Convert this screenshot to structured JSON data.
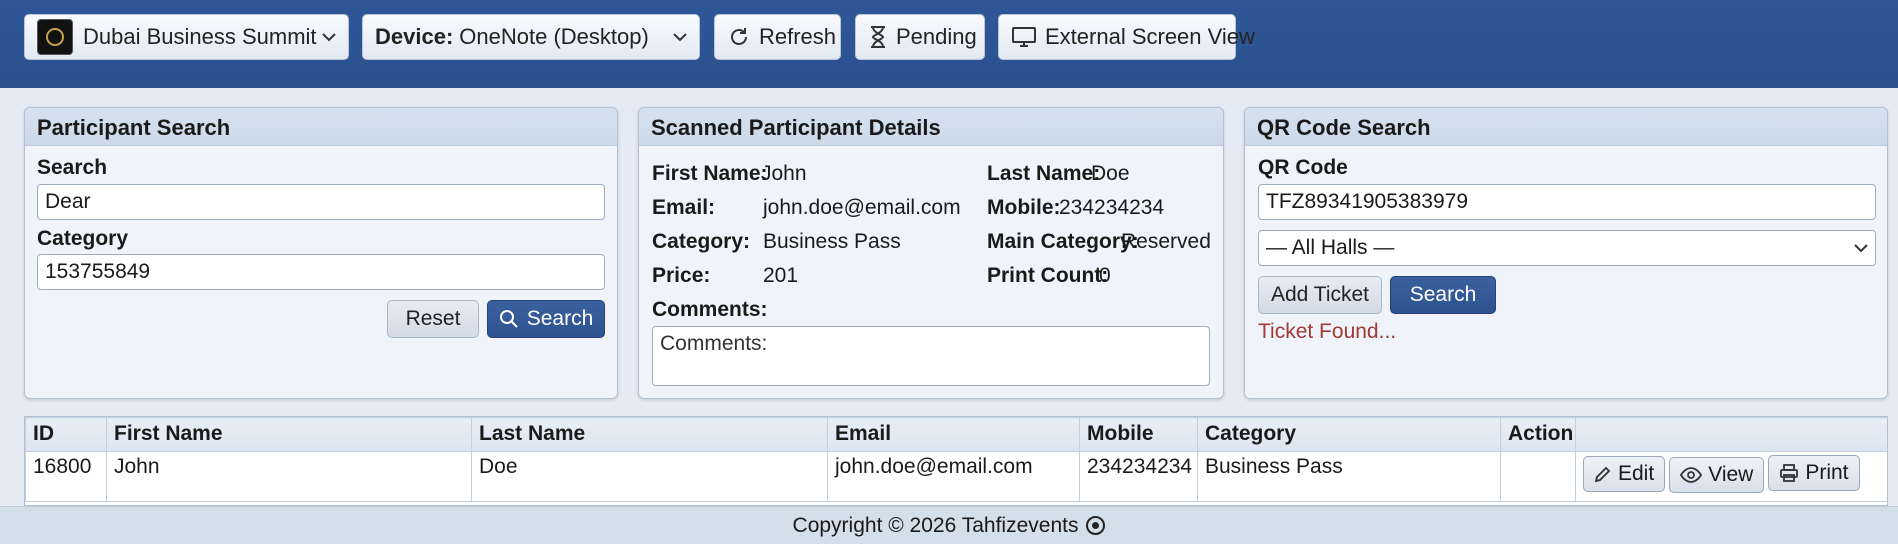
{
  "topbar": {
    "event_name": "Dubai Business Summit",
    "device_label": "Device:",
    "device_value": "OneNote (Desktop)",
    "refresh_label": "Refresh",
    "pending_label": "Pending",
    "external_label": "External Screen View"
  },
  "participant_search": {
    "title": "Participant Search",
    "search_label": "Search",
    "search_value": "Dear",
    "category_label": "Category",
    "category_value": "153755849",
    "reset_label": "Reset",
    "search_button": "Search"
  },
  "scanned": {
    "title": "Scanned Participant Details",
    "first_name_label": "First Name:",
    "first_name": "John",
    "last_name_label": "Last Name:",
    "last_name": "Doe",
    "email_label": "Email:",
    "email": "john.doe@email.com",
    "mobile_label": "Mobile:",
    "mobile": "234234234",
    "category_label": "Category:",
    "category": "Business Pass",
    "main_category_label": "Main Category:",
    "main_category": "Reserved",
    "price_label": "Price:",
    "price": "201",
    "print_count_label": "Print Count:",
    "print_count": "0",
    "comments_label": "Comments:",
    "comments_placeholder": "Comments:"
  },
  "qr": {
    "title": "QR Code Search",
    "qr_label": "QR Code",
    "qr_value": "TFZ89341905383979",
    "hall_selected": "— All Halls —",
    "add_ticket_label": "Add Ticket",
    "search_button": "Search",
    "status": "Ticket Found..."
  },
  "table": {
    "headers": [
      "ID",
      "First Name",
      "Last Name",
      "Email",
      "Mobile",
      "Category",
      "Action"
    ],
    "rows": [
      {
        "id": "16800",
        "first_name": "John",
        "last_name": "Doe",
        "email": "john.doe@email.com",
        "mobile": "234234234",
        "category": "Business Pass"
      }
    ],
    "edit_label": "Edit",
    "view_label": "View",
    "print_label": "Print"
  },
  "footer": {
    "copyright": "Copyright © 2026 Tahfizevents"
  },
  "colors": {
    "header_blue": "#2f5797",
    "primary_button": "#2e5290",
    "status_text": "#a03a32"
  }
}
